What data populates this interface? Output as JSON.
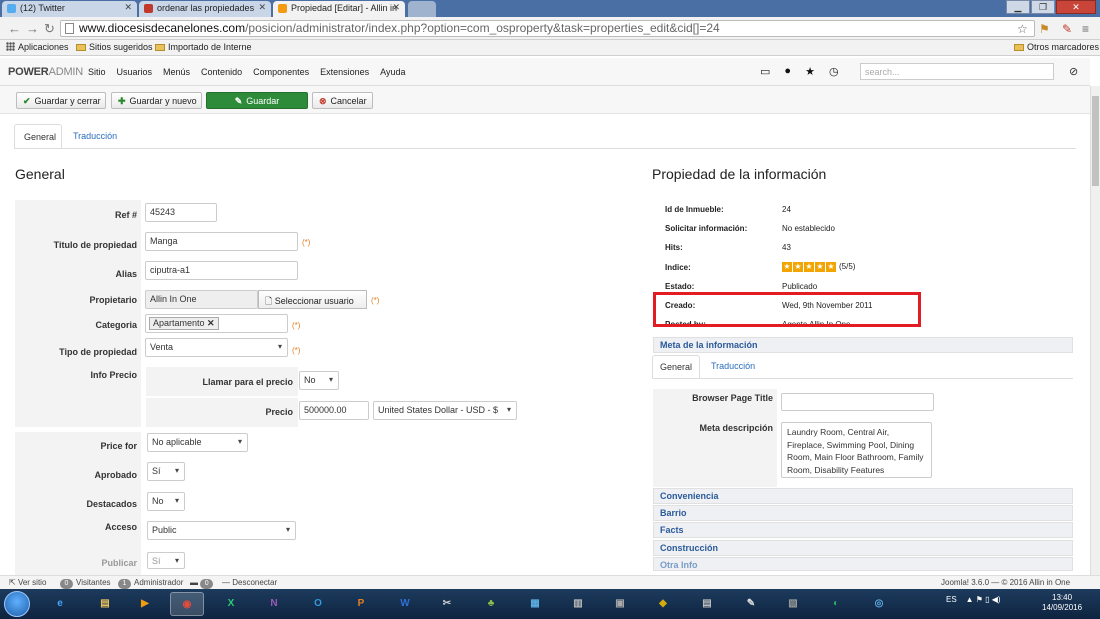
{
  "browser": {
    "tabs": [
      {
        "label": "(12) Twitter",
        "icon": "twitter-icon",
        "color": "#55acee"
      },
      {
        "label": "ordenar las propiedades",
        "icon": "w-icon",
        "color": "#c0392b"
      },
      {
        "label": "Propiedad [Editar] - Allin in",
        "icon": "joomla-icon",
        "color": "#f39c12"
      }
    ],
    "url_host": "www.diocesisdecanelones.com",
    "url_path": "/posicion/administrator/index.php?option=com_osproperty&task=properties_edit&cid[]=24",
    "bookmarks": [
      "Aplicaciones",
      "Sitios sugeridos",
      "Importado de Interne"
    ],
    "other_bookmarks": "Otros marcadores"
  },
  "admin": {
    "brand_bold": "POWER",
    "brand_light": "ADMIN",
    "menu": [
      "Sitio",
      "Usuarios",
      "Menús",
      "Contenido",
      "Componentes",
      "Extensiones",
      "Ayuda"
    ],
    "search_placeholder": "search..."
  },
  "toolbar": {
    "save_close": "Guardar y cerrar",
    "save_new": "Guardar y nuevo",
    "save": "Guardar",
    "cancel": "Cancelar"
  },
  "tabs": [
    "General",
    "Traducción"
  ],
  "left": {
    "heading": "General",
    "fields": {
      "ref_label": "Ref #",
      "ref_value": "45243",
      "title_label": "Titulo de propiedad",
      "title_value": "Manga",
      "alias_label": "Alias",
      "alias_value": "ciputra-a1",
      "owner_label": "Propietario",
      "owner_value": "Allin In One",
      "owner_button": "Seleccionar usuario",
      "category_label": "Categoria",
      "category_chip": "Apartamento",
      "type_label": "Tipo de propiedad",
      "type_value": "Venta",
      "price_info_label": "Info Precio",
      "call_price_label": "Llamar para el precio",
      "call_price_value": "No",
      "price_label": "Precio",
      "price_value": "500000.00",
      "currency_value": "United States Dollar - USD - $",
      "price_for_label": "Price for",
      "price_for_value": "No aplicable",
      "approved_label": "Aprobado",
      "approved_value": "Sí",
      "featured_label": "Destacados",
      "featured_value": "No",
      "access_label": "Acceso",
      "access_value": "Public",
      "publish_label": "Publicar",
      "publish_value": "Sí",
      "required_mark": "(*)"
    }
  },
  "right": {
    "heading": "Propiedad de la información",
    "info": [
      {
        "label": "Id de Inmueble:",
        "value": "24"
      },
      {
        "label": "Solicitar información:",
        "value": "No establecido"
      },
      {
        "label": "Hits:",
        "value": "43"
      },
      {
        "label": "Indice:",
        "value": "(5/5)",
        "stars": 5
      },
      {
        "label": "Estado:",
        "value": "Publicado"
      },
      {
        "label": "Creado:",
        "value": "Wed, 9th November 2011"
      },
      {
        "label": "Posted by:",
        "value": "Agente Allin In One"
      }
    ],
    "meta_heading": "Meta de la información",
    "meta_tabs": [
      "General",
      "Traducción"
    ],
    "browser_title_label": "Browser Page Title",
    "browser_title_value": "",
    "meta_desc_label": "Meta descripción",
    "meta_desc_value": "Laundry Room, Central Air, Fireplace, Swimming Pool, Dining Room, Main Floor Bathroom, Family Room, Disability Features",
    "accordions": [
      "Conveniencia",
      "Barrio",
      "Facts",
      "Construcción",
      "Otra Info"
    ]
  },
  "statusbar": {
    "view_site": "Ver sitio",
    "visitors_count": "0",
    "visitors_label": "Visitantes",
    "admin_count": "1",
    "admin_label": "Administrador",
    "msg_count": "0",
    "logout": "Desconectar",
    "version": "Joomla! 3.6.0 — © 2016 Allin in One"
  },
  "taskbar": {
    "lang": "ES",
    "time": "13:40",
    "date": "14/09/2016"
  }
}
